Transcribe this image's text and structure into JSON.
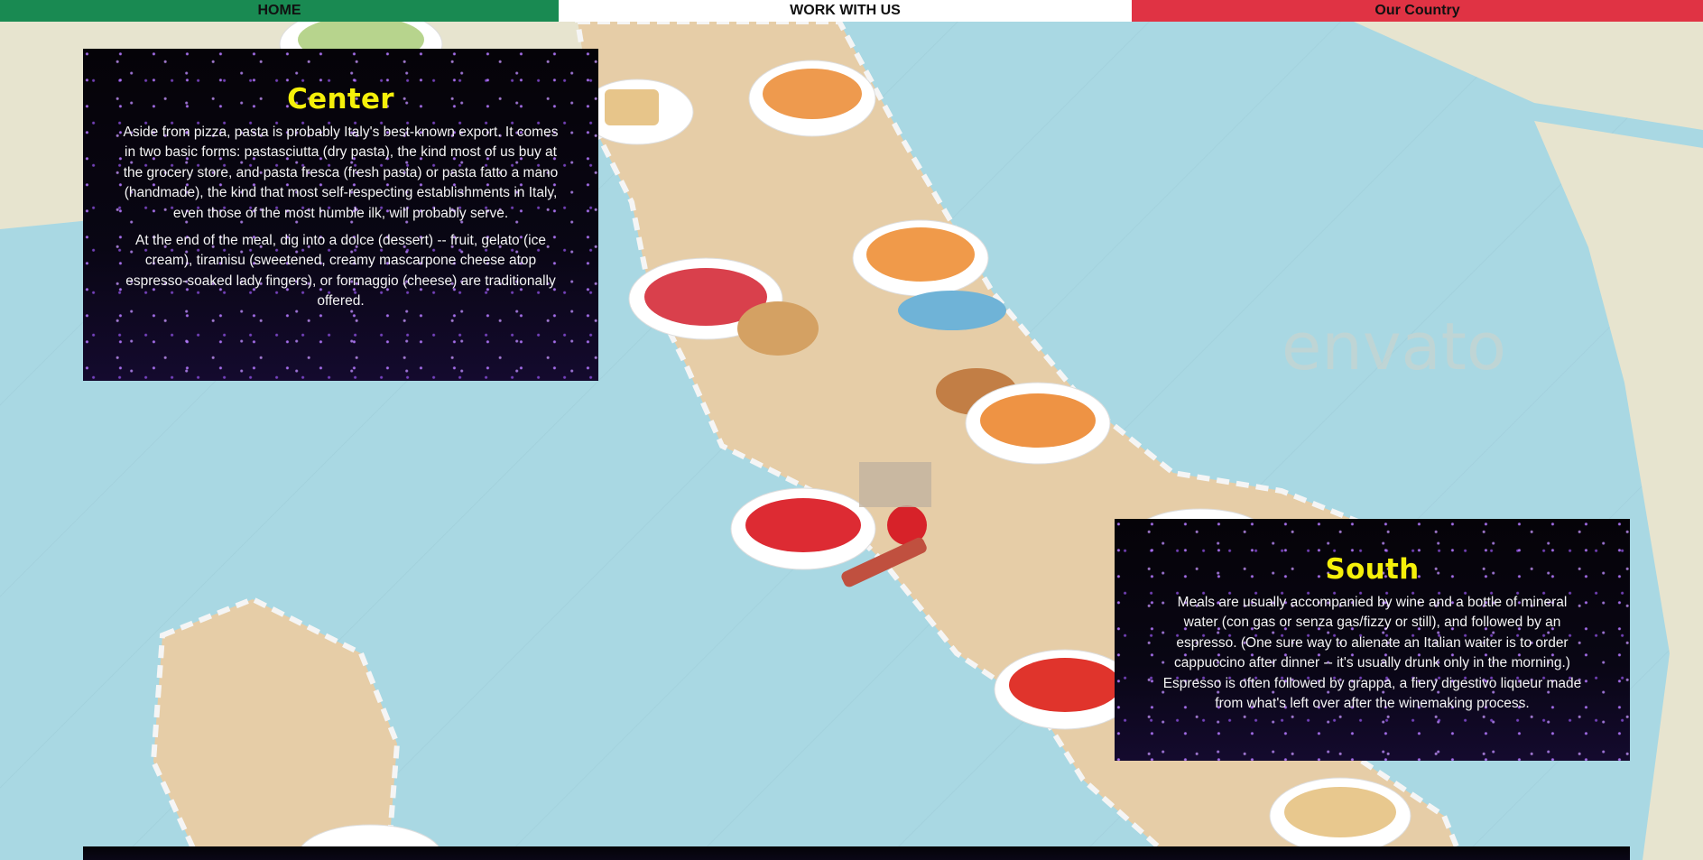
{
  "nav": {
    "home_label": "HOME",
    "work_label": "WORK WITH US",
    "country_label": "Our Country",
    "colors": {
      "home": "#198a52",
      "work": "#ffffff",
      "country": "#e03344"
    }
  },
  "watermark": "envato",
  "sections": {
    "center": {
      "title": "Center",
      "paragraphs": [
        "Aside from pizza, pasta is probably Italy's best-known export. It comes in two basic forms: pastasciutta (dry pasta), the kind most of us buy at the grocery store, and pasta fresca (fresh pasta) or pasta fatto a mano (handmade), the kind that most self-respecting establishments in Italy, even those of the most humble ilk, will probably serve.",
        "At the end of the meal, dig into a dolce (dessert) -- fruit, gelato (ice cream), tiramisu (sweetened, creamy mascarpone cheese atop espresso-soaked lady fingers), or formaggio (cheese) are traditionally offered."
      ]
    },
    "south": {
      "title": "South",
      "paragraphs": [
        "Meals are usually accompanied by wine and a bottle of mineral water (con gas or senza gas/fizzy or still), and followed by an espresso. (One sure way to alienate an Italian waiter is to order cappuccino after dinner -- it's usually drunk only in the morning.) Espresso is often followed by grappa, a fiery digestivo liqueur made from what's left over after the winemaking process."
      ]
    }
  },
  "colors": {
    "title": "#f5f00a",
    "sea": "#a9d8e3",
    "land": "#e6cda7"
  }
}
